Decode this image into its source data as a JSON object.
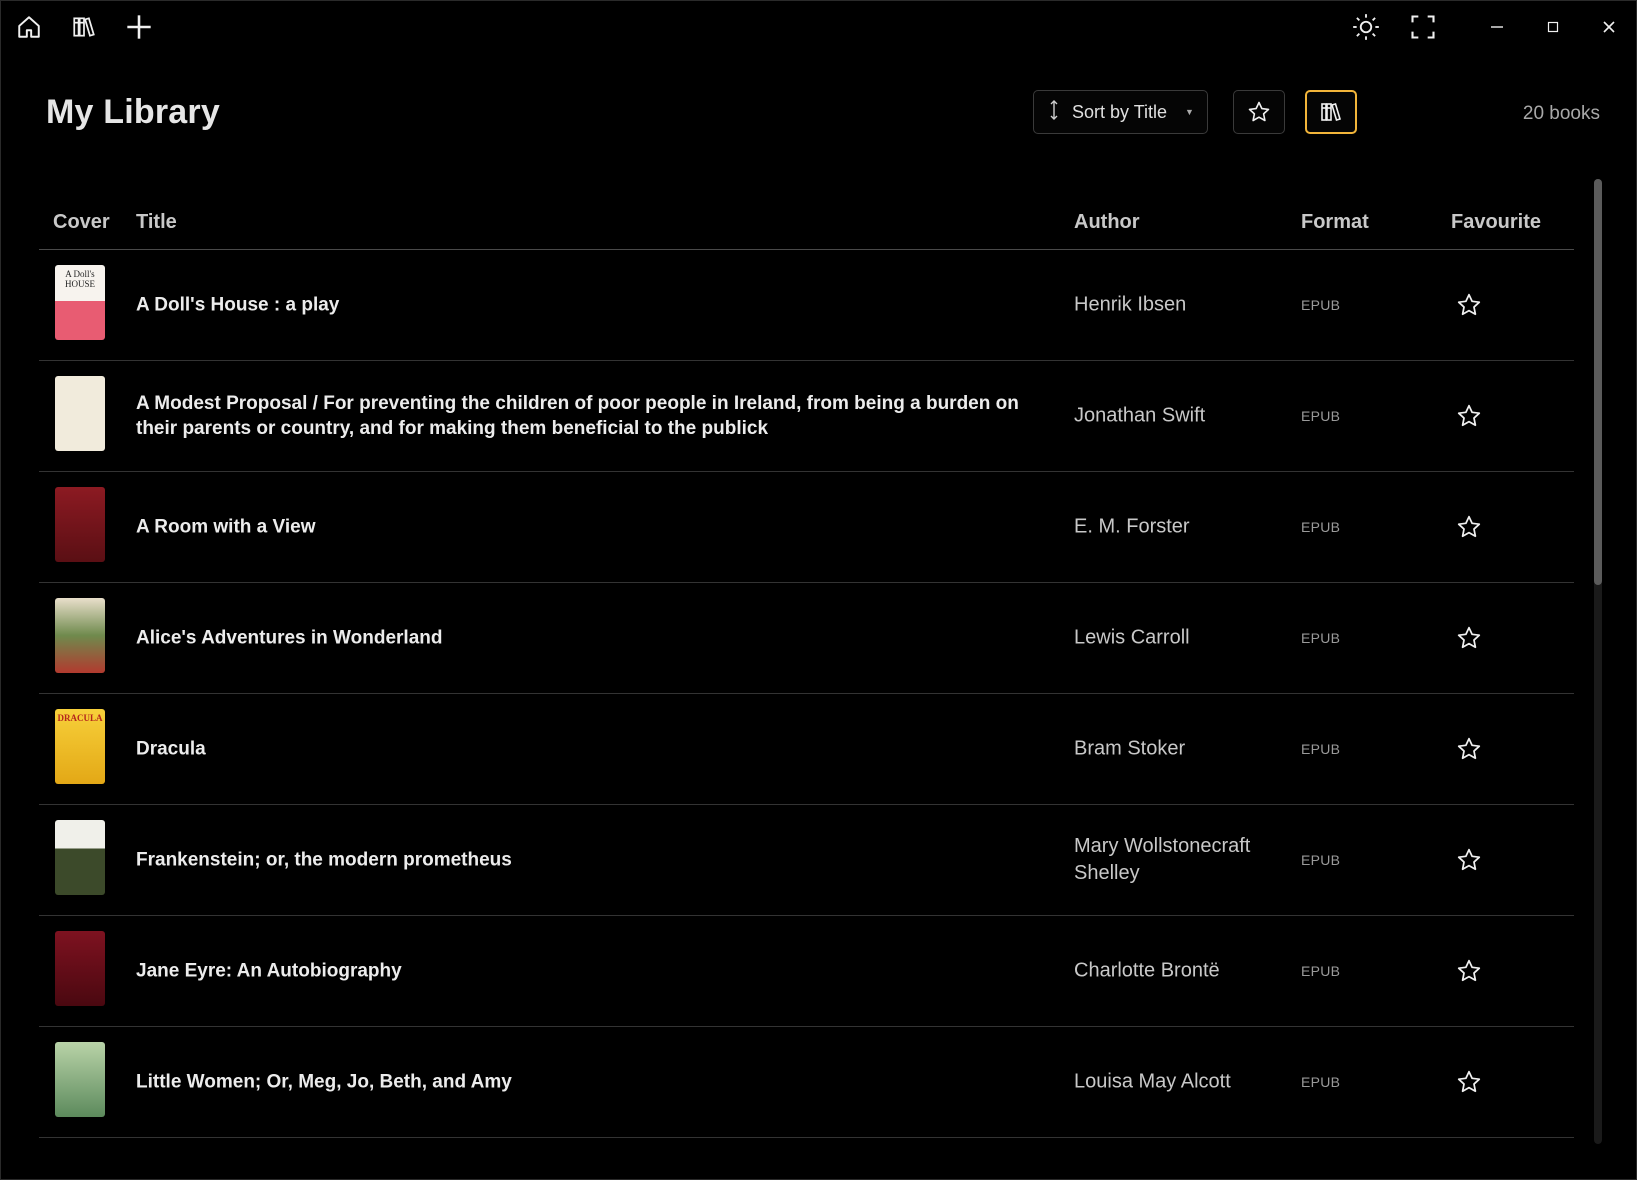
{
  "titlebar": {
    "home_icon": "home-icon",
    "library_icon": "library-icon",
    "add_icon": "plus-icon",
    "theme_icon": "sun-icon",
    "fullscreen_icon": "fullscreen-icon",
    "minimize_icon": "minimize-icon",
    "maximize_icon": "maximize-icon",
    "close_icon": "close-icon"
  },
  "header": {
    "title": "My Library",
    "sort_label": "Sort by Title",
    "books_count": "20 books",
    "accent_color": "#f2b53a"
  },
  "table": {
    "columns": [
      "Cover",
      "Title",
      "Author",
      "Format",
      "Favourite"
    ],
    "rows": [
      {
        "title": "A Doll's House : a play",
        "author": "Henrik Ibsen",
        "format": "EPUB"
      },
      {
        "title": "A Modest Proposal / For preventing the children of poor people in Ireland, from being a burden on their parents or country, and for making them beneficial to the publick",
        "author": "Jonathan Swift",
        "format": "EPUB"
      },
      {
        "title": "A Room with a View",
        "author": "E. M. Forster",
        "format": "EPUB"
      },
      {
        "title": "Alice's Adventures in Wonderland",
        "author": "Lewis Carroll",
        "format": "EPUB"
      },
      {
        "title": "Dracula",
        "author": "Bram Stoker",
        "format": "EPUB"
      },
      {
        "title": "Frankenstein; or, the modern prometheus",
        "author": "Mary Wollstonecraft Shelley",
        "format": "EPUB"
      },
      {
        "title": "Jane Eyre: An Autobiography",
        "author": "Charlotte Brontë",
        "format": "EPUB"
      },
      {
        "title": "Little Women; Or, Meg, Jo, Beth, and Amy",
        "author": "Louisa May Alcott",
        "format": "EPUB"
      }
    ]
  },
  "covers": {
    "doll_house_text": "A Doll's HOUSE",
    "dracula_text": "DRACULA"
  }
}
